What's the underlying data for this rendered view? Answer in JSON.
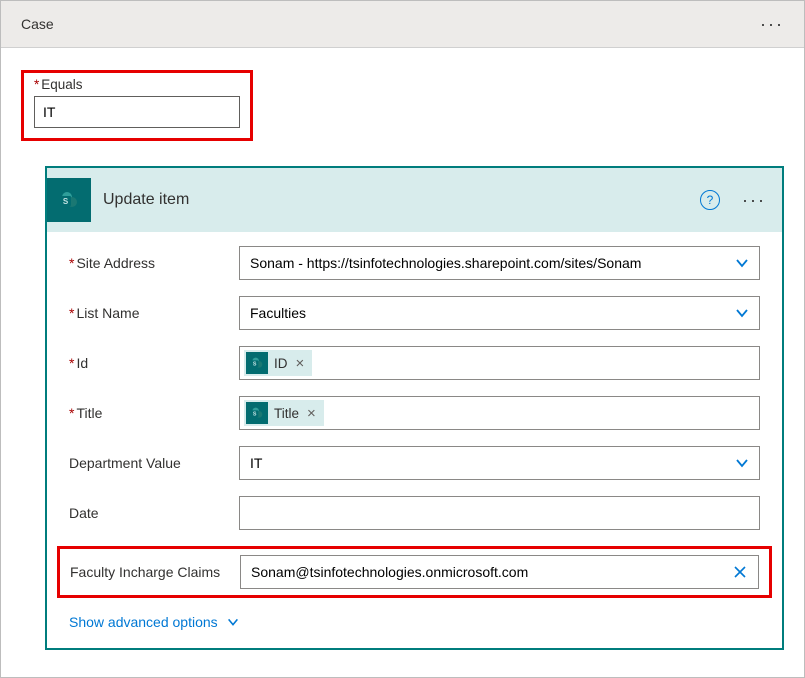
{
  "case": {
    "title": "Case",
    "equals_label": "Equals",
    "equals_value": "IT"
  },
  "action": {
    "title": "Update item",
    "help_glyph": "?",
    "show_advanced": "Show advanced options",
    "fields": {
      "site_address": {
        "label": "Site Address",
        "value": "Sonam - https://tsinfotechnologies.sharepoint.com/sites/Sonam",
        "required": true
      },
      "list_name": {
        "label": "List Name",
        "value": "Faculties",
        "required": true
      },
      "id": {
        "label": "Id",
        "token": "ID",
        "required": true
      },
      "title": {
        "label": "Title",
        "token": "Title",
        "required": true
      },
      "dept": {
        "label": "Department Value",
        "value": "IT"
      },
      "date": {
        "label": "Date",
        "value": ""
      },
      "incharge": {
        "label": "Faculty Incharge Claims",
        "value": "Sonam@tsinfotechnologies.onmicrosoft.com"
      }
    }
  }
}
